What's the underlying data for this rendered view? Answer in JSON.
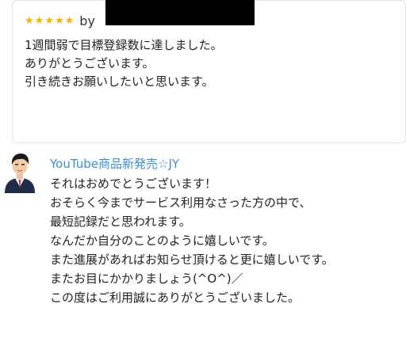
{
  "review": {
    "stars": 5,
    "by_label": "by",
    "lines": [
      "1週間弱で目標登録数に達しました。",
      "ありがとうございます。",
      "引き続きお願いしたいと思います。"
    ]
  },
  "reply": {
    "author": "YouTube商品新発売☆JY",
    "lines": [
      "それはおめでとうございます！",
      "おそらく今までサービス利用なさった方の中で、",
      "最短記録だと思われます。",
      "なんだか自分のことのように嬉しいです。",
      "また進展があればお知らせ頂けると更に嬉しいです。",
      "またお目にかかりましょう(^O^)／",
      "この度はご利用誠にありがとうございました。"
    ]
  },
  "colors": {
    "star": "#f5b301",
    "author": "#3a8fd6",
    "border": "#e3e3e3"
  },
  "icons": {
    "star": "star-icon",
    "avatar": "avatar"
  }
}
